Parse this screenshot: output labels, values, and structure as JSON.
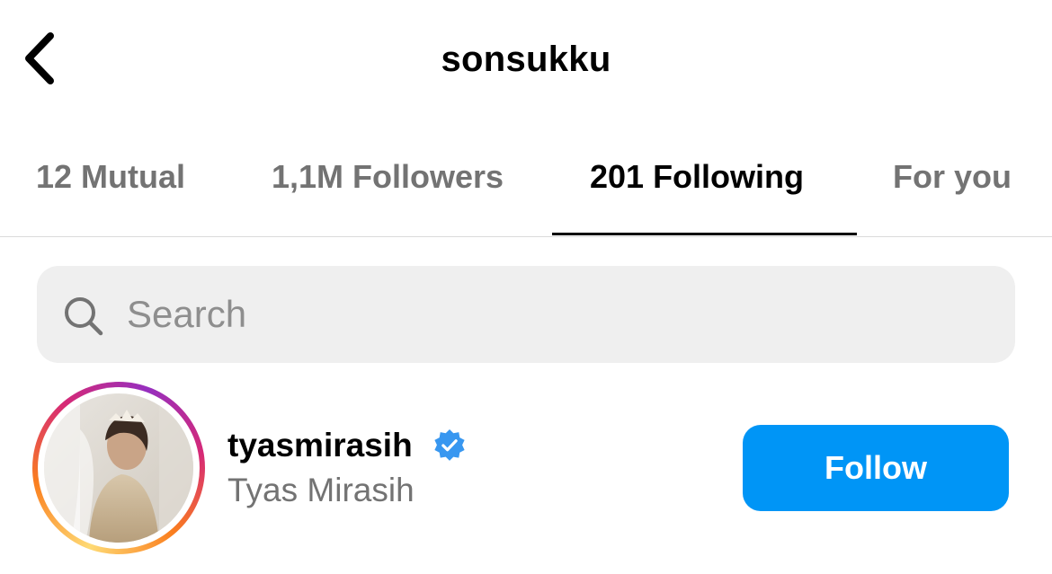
{
  "header": {
    "title": "sonsukku",
    "back_icon": "chevron-left-icon"
  },
  "tabs": [
    {
      "label": "12 Mutual",
      "active": false
    },
    {
      "label": "1,1M Followers",
      "active": false
    },
    {
      "label": "201 Following",
      "active": true
    },
    {
      "label": "For you",
      "active": false
    }
  ],
  "search": {
    "placeholder": "Search",
    "value": "",
    "icon": "search-icon"
  },
  "users": [
    {
      "username": "tyasmirasih",
      "full_name": "Tyas Mirasih",
      "verified": true,
      "has_story_ring": true,
      "button_label": "Follow"
    }
  ],
  "colors": {
    "accent": "#0095f6",
    "verified": "#3897f0",
    "muted_text": "#737373",
    "search_bg": "#efefef",
    "divider": "#dbdbdb"
  }
}
